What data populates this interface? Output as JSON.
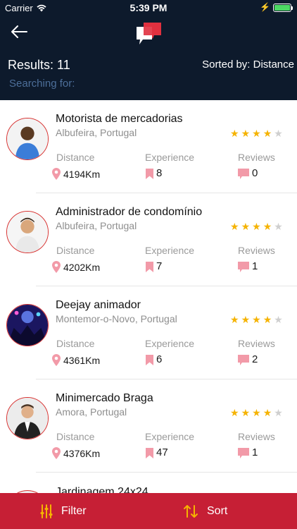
{
  "status_bar": {
    "carrier": "Carrier",
    "time": "5:39 PM"
  },
  "header": {
    "results_label": "Results: 11",
    "sorted_label": "Sorted by: Distance",
    "searching_label": "Searching for:"
  },
  "labels": {
    "distance": "Distance",
    "experience": "Experience",
    "reviews": "Reviews"
  },
  "colors": {
    "header_bg": "#0d1a2c",
    "accent_red": "#c61f35",
    "star": "#f5b301",
    "pin": "#f29aa8"
  },
  "cards": [
    {
      "name": "Motorista de mercadorias",
      "location": "Albufeira, Portugal",
      "rating": 4,
      "distance": "4194Km",
      "experience": "8",
      "reviews": "0"
    },
    {
      "name": "Administrador de condomínio",
      "location": "Albufeira, Portugal",
      "rating": 4,
      "distance": "4202Km",
      "experience": "7",
      "reviews": "1"
    },
    {
      "name": "Deejay animador",
      "location": "Montemor-o-Novo, Portugal",
      "rating": 4,
      "distance": "4361Km",
      "experience": "6",
      "reviews": "2"
    },
    {
      "name": "Minimercado Braga",
      "location": "Amora, Portugal",
      "rating": 4,
      "distance": "4376Km",
      "experience": "47",
      "reviews": "1"
    },
    {
      "name": "Jardinagem 24x24"
    }
  ],
  "bottom_bar": {
    "filter_label": "Filter",
    "sort_label": "Sort"
  }
}
